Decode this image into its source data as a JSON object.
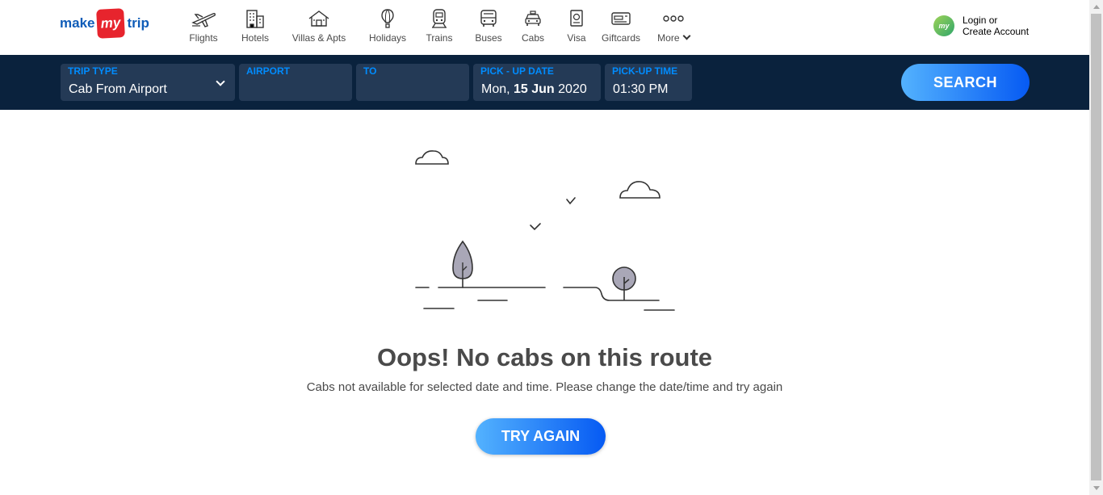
{
  "brand": {
    "make": "make",
    "my": "my",
    "trip": "trip",
    "color": "#0f5cb8",
    "accent": "#e7242d"
  },
  "nav": {
    "items": [
      {
        "label": "Flights",
        "icon": "plane-icon"
      },
      {
        "label": "Hotels",
        "icon": "building-icon"
      },
      {
        "label": "Villas & Apts",
        "icon": "house-icon"
      },
      {
        "label": "Holidays",
        "icon": "hot-air-balloon-icon"
      },
      {
        "label": "Trains",
        "icon": "train-icon"
      },
      {
        "label": "Buses",
        "icon": "bus-icon"
      },
      {
        "label": "Cabs",
        "icon": "car-icon"
      },
      {
        "label": "Visa",
        "icon": "passport-icon"
      },
      {
        "label": "Giftcards",
        "icon": "giftcard-icon"
      },
      {
        "label": "More",
        "icon": "more-dots-icon"
      }
    ]
  },
  "login": {
    "avatar": "my",
    "line1": "Login or",
    "line2": "Create Account"
  },
  "search": {
    "trip_type_label": "TRIP TYPE",
    "trip_type_value": "Cab From Airport",
    "airport_label": "AIRPORT",
    "airport_value": "",
    "to_label": "TO",
    "to_value": "",
    "date_label": "PICK - UP DATE",
    "date_day": "Mon, ",
    "date_bold": "15 Jun",
    "date_year": " 2020",
    "time_label": "PICK-UP TIME",
    "time_value": "01:30 PM",
    "button": "SEARCH"
  },
  "empty": {
    "title": "Oops! No cabs on this route",
    "message": "Cabs not available for selected date and time. Please change the date/time and try again",
    "button": "TRY AGAIN"
  },
  "colors": {
    "header_bg": "#0a223d",
    "field_bg": "#243a56",
    "label_blue": "#008cff",
    "button_from": "#53b2fe",
    "button_to": "#065af3"
  }
}
